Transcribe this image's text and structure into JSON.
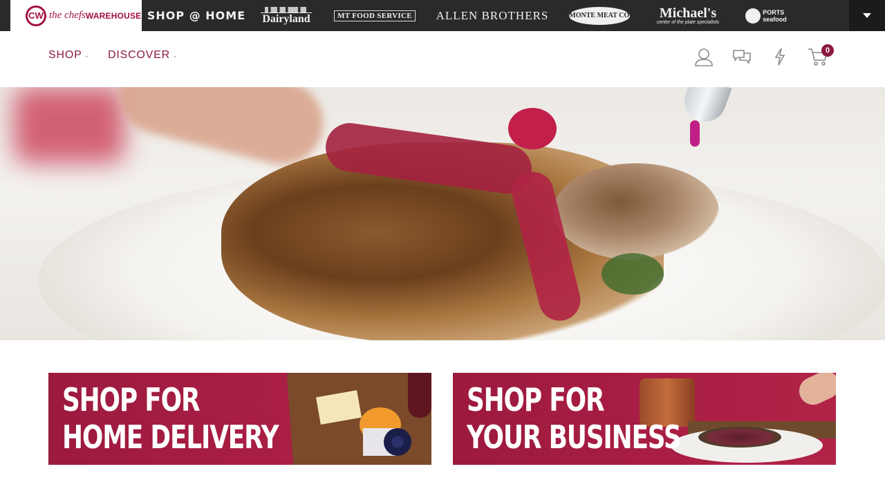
{
  "brandbar": {
    "home": {
      "mark": "CW",
      "word1": "the chefs",
      "word2": "WAREHOUSE"
    },
    "shop_at_home": "SHOP @ HOME",
    "dairyland": "Dairyland",
    "mt": "MT FOOD SERVICE",
    "allen": "ALLEN BROTHERS",
    "delmonte": "DEL MONTE MEAT CO LLC",
    "michaels": {
      "name": "Michael's",
      "sub": "center of the plate specialists"
    },
    "ports": {
      "line1": "PORTS",
      "line2": "seafood"
    }
  },
  "nav": {
    "items": [
      {
        "label": "SHOP"
      },
      {
        "label": "DISCOVER"
      }
    ],
    "icons": [
      "account-icon",
      "chat-icon",
      "lightning-icon",
      "cart-icon"
    ],
    "cart_count": "0"
  },
  "promos": [
    {
      "line1": "SHOP FOR",
      "line2": "HOME DELIVERY"
    },
    {
      "line1": "SHOP FOR",
      "line2": "YOUR BUSINESS"
    }
  ],
  "colors": {
    "brand": "#8b1a3e",
    "banner": "#a81d43",
    "topbar": "#2a2a2a"
  }
}
